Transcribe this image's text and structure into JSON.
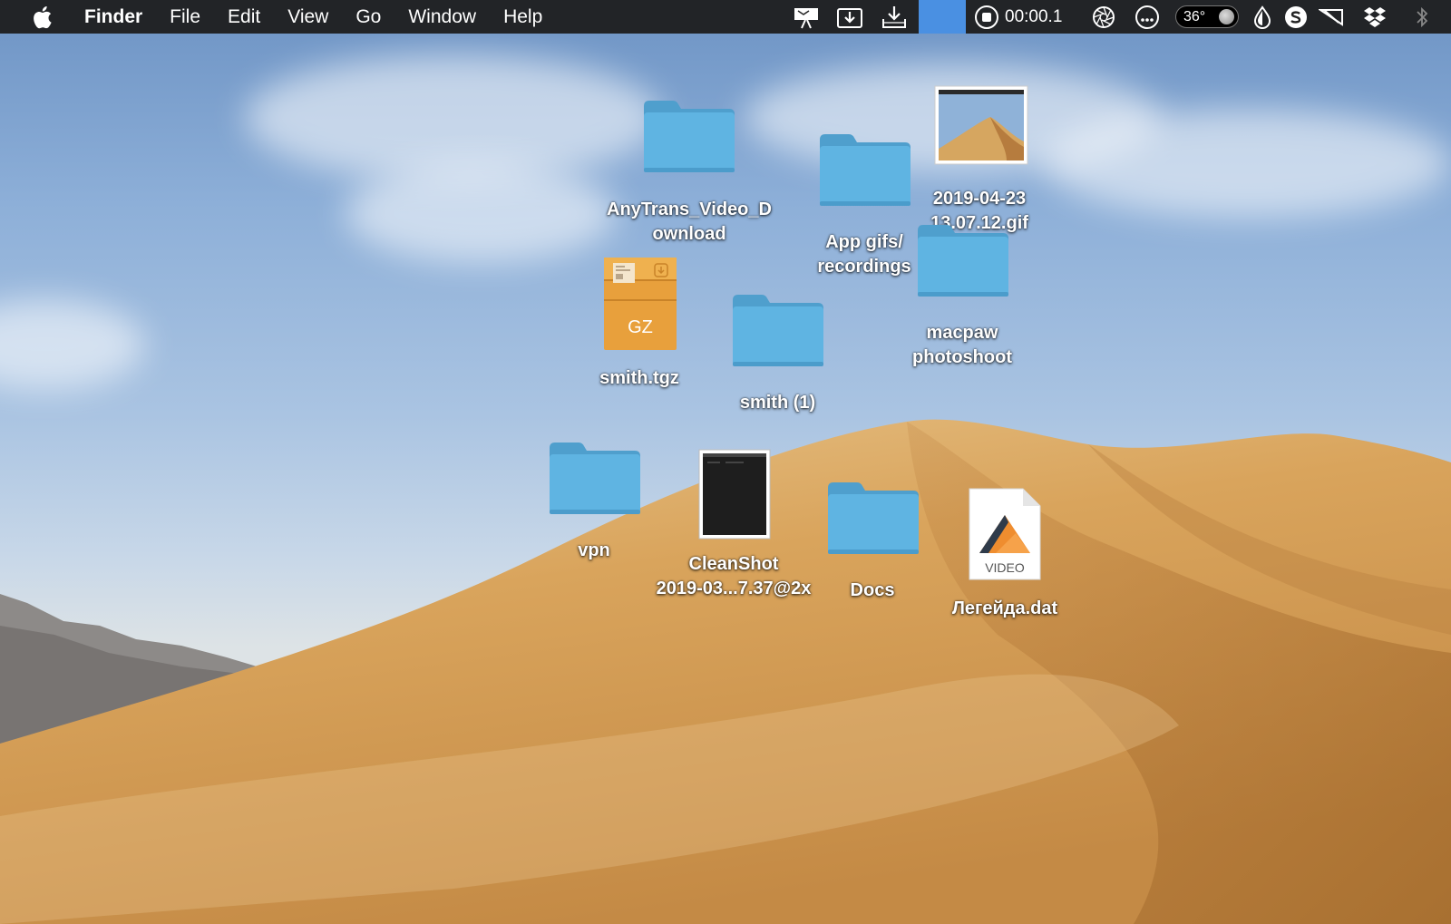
{
  "menubar": {
    "app_name": "Finder",
    "menus": [
      "File",
      "Edit",
      "View",
      "Go",
      "Window",
      "Help"
    ],
    "timer": "00:00.1",
    "temperature": "36°",
    "status_icons": [
      "keynote-icon",
      "download-box-icon",
      "download-tray-icon",
      "record-stop-icon",
      "aperture-icon",
      "more-circle-icon",
      "temperature-widget",
      "drop-icon",
      "skype-icon",
      "flag-icon",
      "dropbox-icon",
      "bluetooth-icon"
    ]
  },
  "desktop_items": [
    {
      "kind": "folder",
      "label": "AnyTrans_Video_D\nownload"
    },
    {
      "kind": "folder",
      "label": "App gifs/\nrecordings"
    },
    {
      "kind": "image",
      "label": "2019-04-23\n13.07.12.gif"
    },
    {
      "kind": "archive",
      "label": "smith.tgz",
      "badge": "GZ"
    },
    {
      "kind": "folder",
      "label": "smith (1)"
    },
    {
      "kind": "folder",
      "label": "macpaw\nphotoshoot"
    },
    {
      "kind": "folder",
      "label": "vpn"
    },
    {
      "kind": "screenshot",
      "label": "CleanShot\n2019-03...7.37@2x"
    },
    {
      "kind": "folder",
      "label": "Docs"
    },
    {
      "kind": "video",
      "label": "Легейда.dat",
      "badge": "VIDEO"
    }
  ],
  "colors": {
    "menubar_bg": "#222427",
    "folder": "#5fb4e2",
    "folder_tab": "#4f9fcd",
    "archive": "#e8a03c",
    "sand": "#d9a45c"
  }
}
